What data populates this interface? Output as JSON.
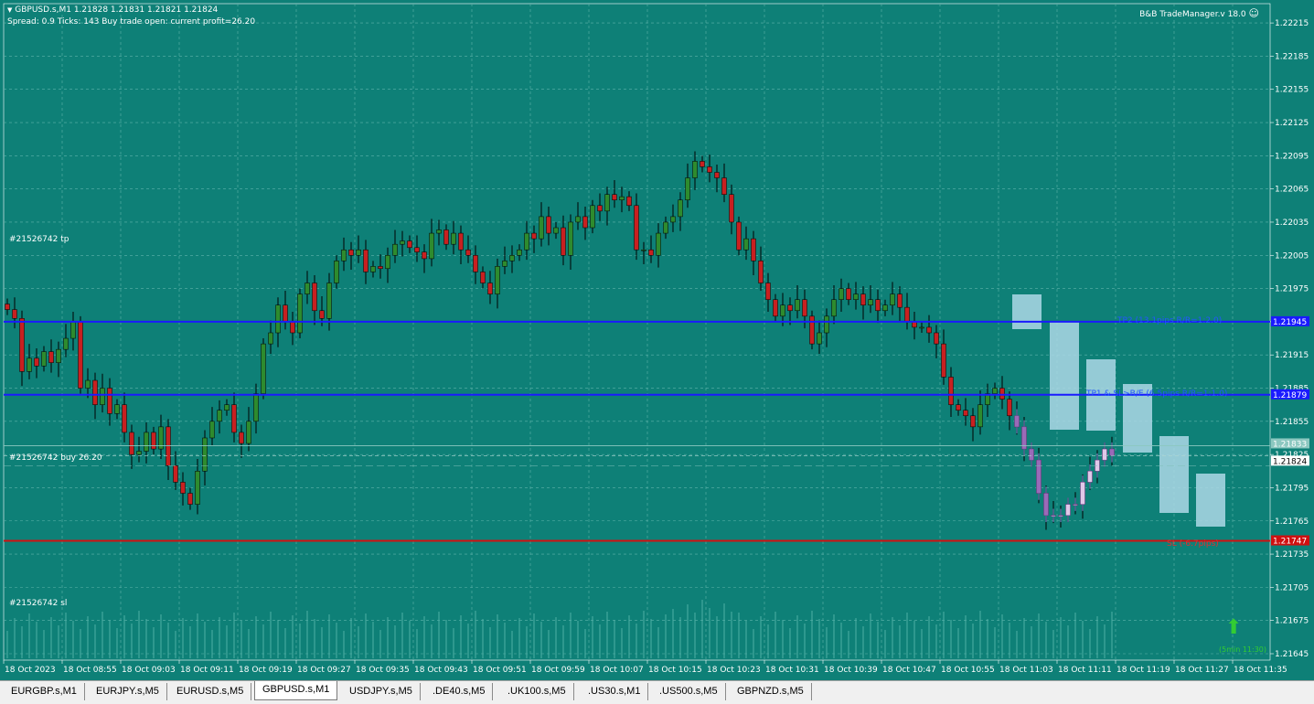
{
  "header": {
    "symbol_line": "GBPUSD.s,M1  1.21828 1.21831 1.21821 1.21824",
    "info_line": "Spread: 0.9  Ticks: 143  Buy trade open: current profit=26.20",
    "plugin": "B&B TradeManager.v 18.0"
  },
  "trade_labels": {
    "tp": "#21526742 tp",
    "buy": "#21526742 buy 26.20",
    "sl": "#21526742 sl"
  },
  "levels": {
    "tp2": {
      "price": 1.21945,
      "label": "1.21945",
      "text": "TP2 (13.1pips R/R=1:2.0)"
    },
    "tp1": {
      "price": 1.21879,
      "label": "1.21879",
      "text": "TP1 & SL>B/E (6.5pips R/R=1:1.0)"
    },
    "sl": {
      "price": 1.21747,
      "label": "1.21747",
      "text": "SL (-6.7pips)"
    },
    "entry": {
      "price": 1.21833,
      "label": "1.21833"
    },
    "bid": {
      "price": 1.21824,
      "label": "1.21824"
    }
  },
  "countdown": "(5min 11:30)",
  "chart_data": {
    "type": "candlestick",
    "symbol": "GBPUSD.s",
    "timeframe": "M1",
    "ylim": [
      1.21645,
      1.22225
    ],
    "y_ticks": [
      "1.22215",
      "1.22185",
      "1.22155",
      "1.22125",
      "1.22095",
      "1.22065",
      "1.22035",
      "1.22005",
      "1.21975",
      "1.21945",
      "1.21915",
      "1.21885",
      "1.21855",
      "1.21825",
      "1.21795",
      "1.21765",
      "1.21735",
      "1.21705",
      "1.21675",
      "1.21645"
    ],
    "x_ticks": [
      "18 Oct 2023",
      "18 Oct 08:55",
      "18 Oct 09:03",
      "18 Oct 09:11",
      "18 Oct 09:19",
      "18 Oct 09:27",
      "18 Oct 09:35",
      "18 Oct 09:43",
      "18 Oct 09:51",
      "18 Oct 09:59",
      "18 Oct 10:07",
      "18 Oct 10:15",
      "18 Oct 10:23",
      "18 Oct 10:31",
      "18 Oct 10:39",
      "18 Oct 10:47",
      "18 Oct 10:55",
      "18 Oct 11:03",
      "18 Oct 11:11",
      "18 Oct 11:19",
      "18 Oct 11:27",
      "18 Oct 11:35"
    ],
    "closes": [
      1.21956,
      1.21948,
      1.219,
      1.21912,
      1.21905,
      1.21918,
      1.21908,
      1.2192,
      1.2193,
      1.21945,
      1.21885,
      1.21892,
      1.2187,
      1.21885,
      1.21862,
      1.2187,
      1.21845,
      1.21825,
      1.21828,
      1.21845,
      1.2183,
      1.2185,
      1.21815,
      1.218,
      1.2179,
      1.2178,
      1.2181,
      1.2184,
      1.21855,
      1.21865,
      1.2187,
      1.21845,
      1.21835,
      1.21855,
      1.2188,
      1.21925,
      1.21935,
      1.2196,
      1.21945,
      1.21935,
      1.2197,
      1.2198,
      1.21955,
      1.21948,
      1.2198,
      1.22,
      1.2201,
      1.22005,
      1.2201,
      1.2199,
      1.21995,
      1.21993,
      1.22005,
      1.22015,
      1.22018,
      1.22012,
      1.22008,
      1.22002,
      1.22025,
      1.22028,
      1.22015,
      1.22025,
      1.2201,
      1.22005,
      1.2199,
      1.2198,
      1.2197,
      1.21995,
      1.22,
      1.22005,
      1.2201,
      1.22025,
      1.2202,
      1.2204,
      1.22025,
      1.2203,
      1.22005,
      1.22035,
      1.2204,
      1.2203,
      1.2205,
      1.22045,
      1.2206,
      1.22055,
      1.22058,
      1.2205,
      1.2201,
      1.2201,
      1.22005,
      1.22025,
      1.22035,
      1.2204,
      1.22055,
      1.22075,
      1.2209,
      1.22085,
      1.2208,
      1.22075,
      1.2206,
      1.22035,
      1.2201,
      1.2202,
      1.22,
      1.2198,
      1.21965,
      1.2195,
      1.2196,
      1.21955,
      1.21965,
      1.2195,
      1.21925,
      1.21935,
      1.2195,
      1.21965,
      1.21975,
      1.21965,
      1.2197,
      1.2196,
      1.21965,
      1.21955,
      1.2196,
      1.2197,
      1.21958,
      1.21945,
      1.2194,
      1.2194,
      1.21935,
      1.21925,
      1.21895,
      1.2187,
      1.21865,
      1.2186,
      1.2185,
      1.2187,
      1.2188,
      1.21885,
      1.21875,
      1.2186,
      1.2185,
      1.2183,
      1.2182,
      1.2179,
      1.2177,
      1.2177,
      1.2177,
      1.2178,
      1.2178,
      1.218,
      1.2181,
      1.2182,
      1.2183,
      1.21824
    ]
  }
}
